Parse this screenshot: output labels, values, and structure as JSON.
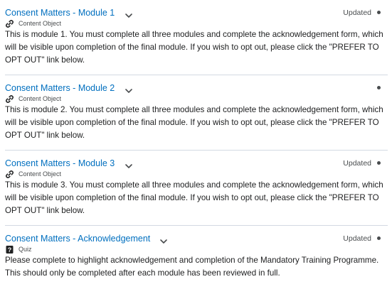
{
  "items": [
    {
      "title": "Consent Matters - Module 1",
      "status": "Updated",
      "type_label": "Content Object",
      "type_icon": "link-icon",
      "description": "This is module 1. You must complete all three modules and complete the acknowledgement form, which will be visible upon completion of the final module. If you wish to opt out, please click the \"PREFER TO OPT OUT\" link below."
    },
    {
      "title": "Consent Matters - Module 2",
      "status": "",
      "type_label": "Content Object",
      "type_icon": "link-icon",
      "description": "This is module 2. You must complete all three modules and complete the acknowledgement form, which will be visible upon completion of the final module. If you wish to opt out, please click the \"PREFER TO OPT OUT\" link below."
    },
    {
      "title": "Consent Matters - Module 3",
      "status": "Updated",
      "type_label": "Content Object",
      "type_icon": "link-icon",
      "description": "This is module 3. You must complete all three modules and complete the acknowledgement form, which will be visible upon completion of the final module. If you wish to opt out, please click the \"PREFER TO OPT OUT\" link below."
    },
    {
      "title": "Consent Matters - Acknowledgement",
      "status": "Updated",
      "type_label": "Quiz",
      "type_icon": "quiz-icon",
      "description": "Please complete to highlight acknowledgement and completion of the Mandatory Training Programme. This should only be completed after each module has been reviewed in full."
    }
  ],
  "colors": {
    "link": "#006fbf",
    "text": "#202122",
    "muted": "#494c4e",
    "divider": "#d3d9e3"
  }
}
